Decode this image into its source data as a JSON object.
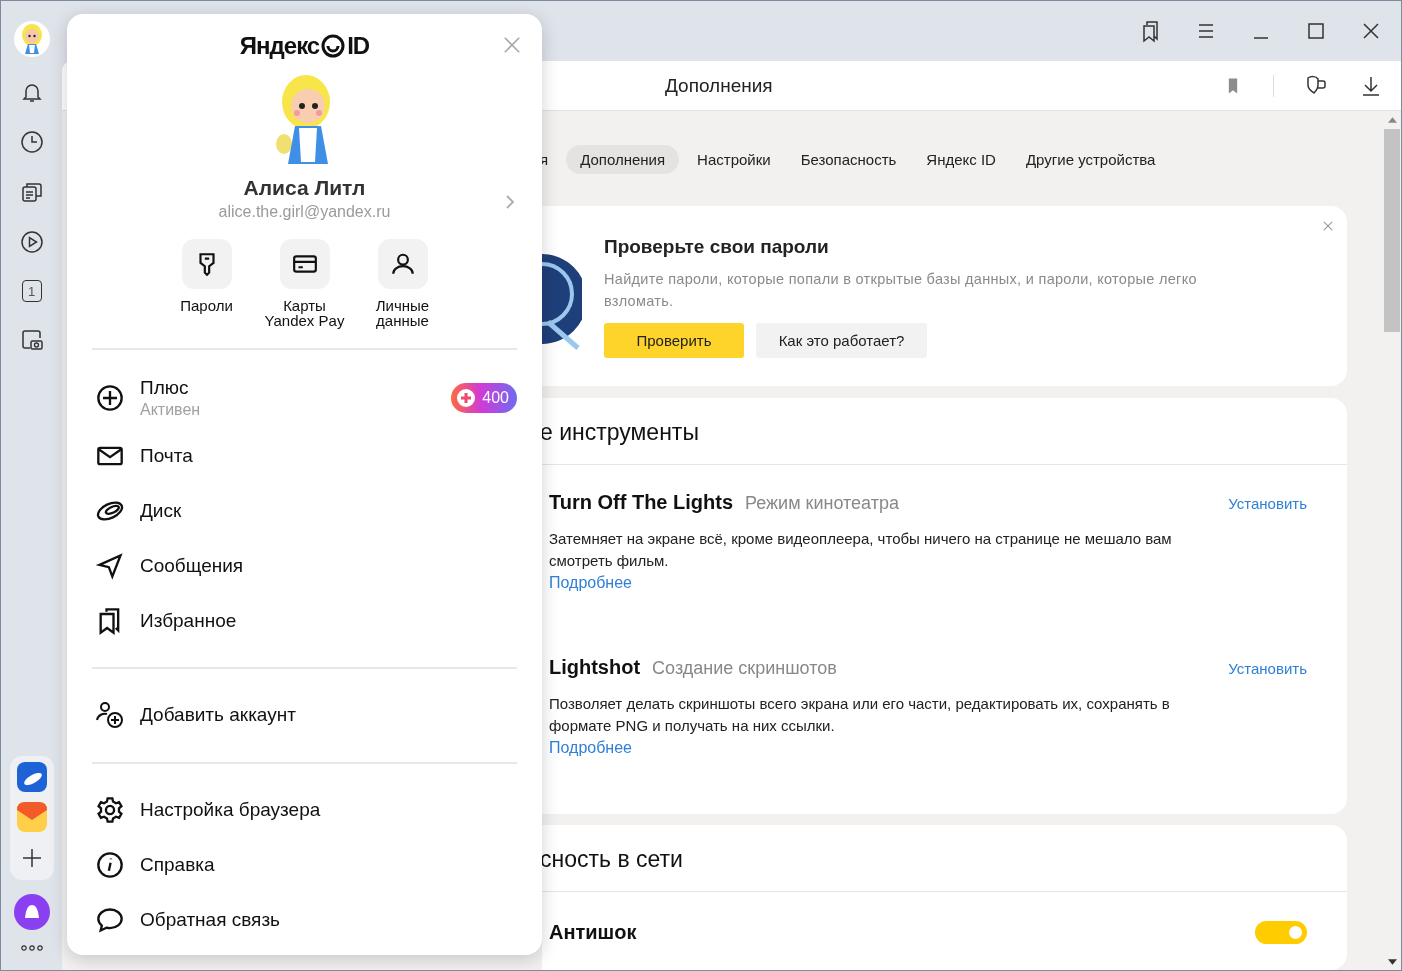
{
  "sidebar": {
    "counter": "1"
  },
  "address_bar": {
    "title": "Дополнения"
  },
  "tabs": [
    {
      "label": "я",
      "selected": false
    },
    {
      "label": "Дополнения",
      "selected": true
    },
    {
      "label": "Настройки",
      "selected": false
    },
    {
      "label": "Безопасность",
      "selected": false
    },
    {
      "label": "Яндекс ID",
      "selected": false
    },
    {
      "label": "Другие устройства",
      "selected": false
    }
  ],
  "password_promo": {
    "title": "Проверьте свои пароли",
    "text": "Найдите пароли, которые попали в открытые базы данных, и пароли, которые легко взломать.",
    "buttons": [
      {
        "label": "Проверить",
        "kind": "primary"
      },
      {
        "label": "Как это работает?",
        "kind": "secondary"
      }
    ]
  },
  "tools_section": {
    "title": "е инструменты",
    "extensions": [
      {
        "name": "Turn Off The Lights",
        "subtitle": "Режим кинотеатра",
        "description": "Затемняет на экране всё, кроме видеоплеера, чтобы ничего на странице не мешало вам смотреть фильм.",
        "link": "Подробнее",
        "action": "Установить"
      },
      {
        "name": "Lightshot",
        "subtitle": "Создание скриншотов",
        "description": "Позволяет делать скриншоты всего экрана или его части, редактировать их, сохранять в формате PNG и получать на них ссылки.",
        "link": "Подробнее",
        "action": "Установить"
      }
    ]
  },
  "security_section": {
    "title": "сность в сети",
    "settings": [
      {
        "name": "Антишок",
        "on": true
      }
    ]
  },
  "account_popup": {
    "logo": "Яндекс",
    "logo_suffix": "ID",
    "name": "Алиса Литл",
    "email": "alice.the.girl@yandex.ru",
    "shortcuts": [
      {
        "label": "Пароли"
      },
      {
        "label": "Карты Yandex Pay"
      },
      {
        "label": "Личные данные"
      }
    ],
    "services": [
      {
        "label": "Плюс",
        "status": "Активен",
        "badge": "400"
      },
      {
        "label": "Почта"
      },
      {
        "label": "Диск"
      },
      {
        "label": "Сообщения"
      },
      {
        "label": "Избранное"
      }
    ],
    "account_actions": [
      {
        "label": "Добавить аккаунт"
      }
    ],
    "menu": [
      {
        "label": "Настройка браузера"
      },
      {
        "label": "Справка"
      },
      {
        "label": "Обратная связь"
      }
    ]
  }
}
